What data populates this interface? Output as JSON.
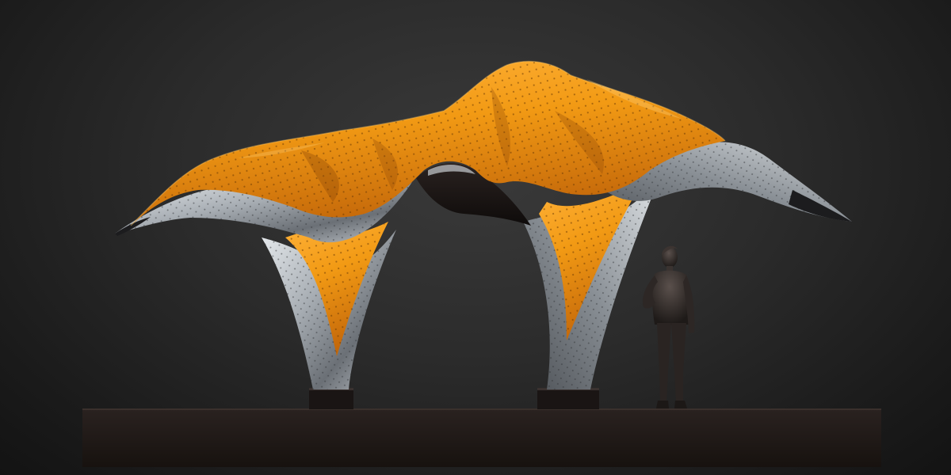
{
  "scene": {
    "subject": "sculpture-render",
    "colors": {
      "background_center": "#3a3a3a",
      "background_edge": "#131313",
      "canopy_orange": "#f29a14",
      "canopy_orange_dark": "#b8620a",
      "metal_silver": "#c9cdd2",
      "metal_dark": "#5c6066",
      "plinth": "#1f1a18",
      "figure": "#2a2523"
    }
  }
}
